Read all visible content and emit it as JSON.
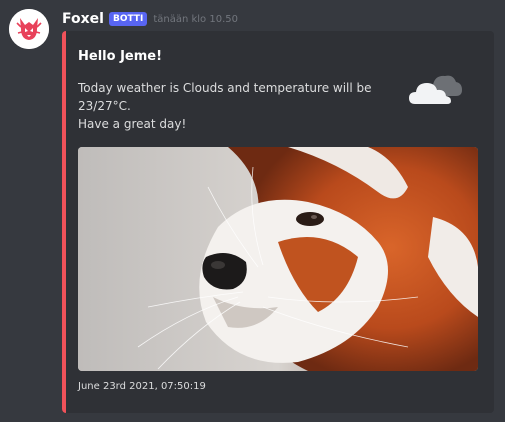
{
  "message": {
    "username": "Foxel",
    "bot_tag": "BOTTI",
    "timestamp": "tänään klo 10.50"
  },
  "embed": {
    "accent_color": "#f0525a",
    "title": "Hello Jeme!",
    "description_line1": "Today weather is Clouds and temperature will be 23/27°C.",
    "description_line2": "Have a great day!",
    "thumbnail_icon": "cloud-icon",
    "image_subject": "red-panda-photo",
    "footer": "June 23rd 2021, 07:50:19"
  },
  "colors": {
    "background": "#36393f",
    "embed_background": "#2f3136",
    "bot_tag": "#5865f2"
  }
}
